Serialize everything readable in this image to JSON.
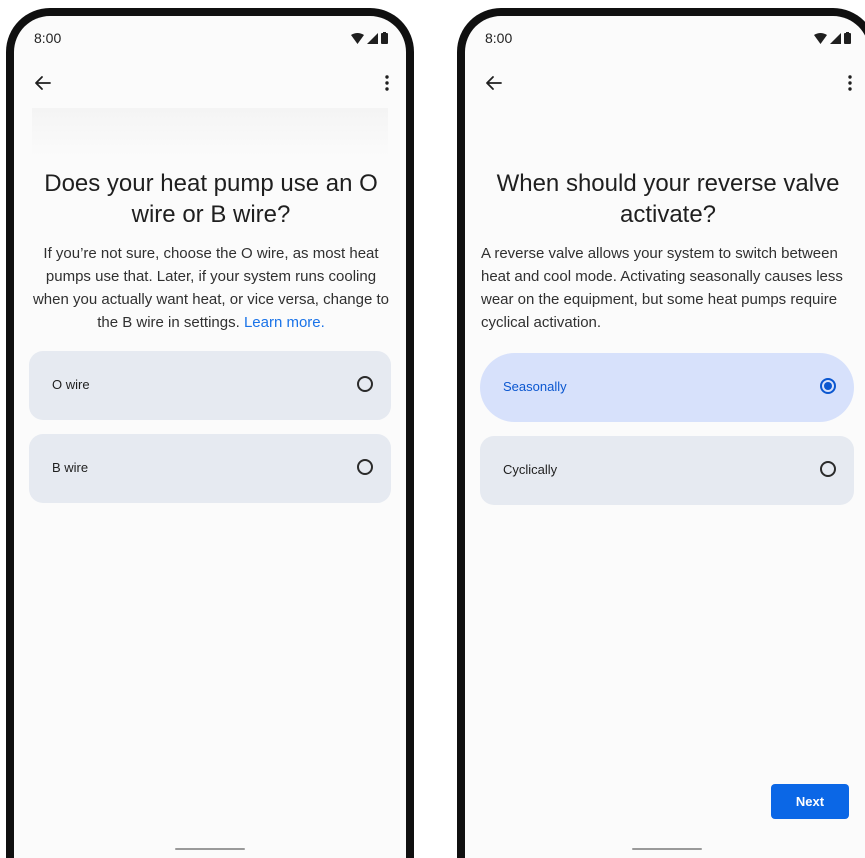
{
  "screens": [
    {
      "status_time": "8:00",
      "title": "Does your heat pump use an O wire or B wire?",
      "description": "If you’re not sure, choose the O wire, as most heat pumps use that. Later, if your system runs cooling when you actually want heat, or vice versa, change to the B wire in settings.",
      "learn_more": "Learn more.",
      "options": [
        {
          "label": "O wire",
          "selected": false
        },
        {
          "label": "B wire",
          "selected": false
        }
      ]
    },
    {
      "status_time": "8:00",
      "title": "When should your reverse valve activate?",
      "description": "A reverse valve allows your system to switch between heat and cool mode. Activating seasonally causes less wear on the equipment, but some heat pumps require cyclical activation.",
      "options": [
        {
          "label": "Seasonally",
          "selected": true
        },
        {
          "label": "Cyclically",
          "selected": false
        }
      ],
      "next_label": "Next"
    }
  ],
  "icons": {
    "back": "arrow-back-icon",
    "menu": "more-vert-icon",
    "wifi": "wifi-icon",
    "cell": "cell-signal-icon",
    "battery": "battery-icon"
  },
  "colors": {
    "accent": "#0b57d0",
    "link": "#1a73e8",
    "option_bg": "#e6eaf1",
    "selected_bg": "#d7e1fb",
    "button": "#0b67e6"
  }
}
